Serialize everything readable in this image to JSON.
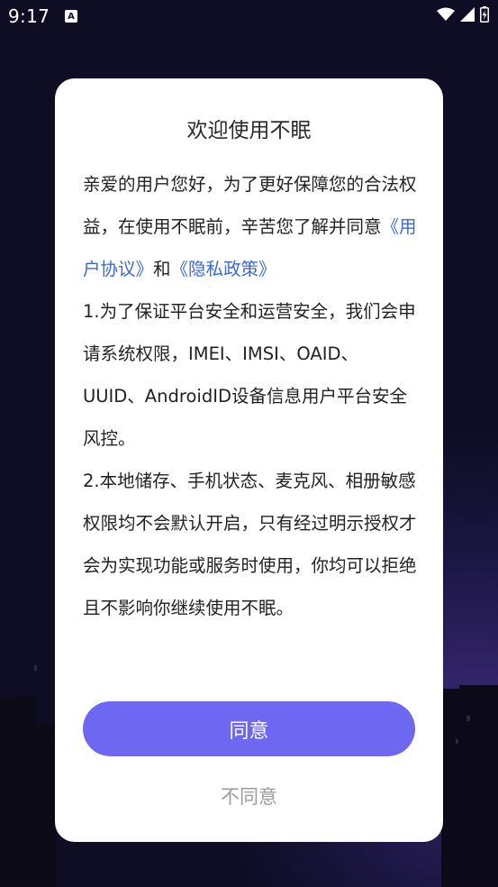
{
  "status_bar": {
    "time": "9:17",
    "notification_icon": "A",
    "icons": [
      "wifi-icon",
      "cellular-signal-icon",
      "battery-charging-icon"
    ]
  },
  "dialog": {
    "title": "欢迎使用不眠",
    "intro_text": "亲爱的用户您好，为了更好保障您的合法权益，在使用不眠前，辛苦您了解并同意",
    "user_agreement_link": "《用户协议》",
    "conjunction": "和",
    "privacy_policy_link": "《隐私政策》",
    "item_1": "1.为了保证平台安全和运营安全，我们会申请系统权限，IMEI、IMSI、OAID、UUID、AndroidID设备信息用户平台安全风控。",
    "item_2": "2.本地储存、手机状态、麦克风、相册敏感权限均不会默认开启，只有经过明示授权才会为实现功能或服务时使用，你均可以拒绝且不影响你继续使用不眠。",
    "agree_label": "同意",
    "disagree_label": "不同意"
  },
  "colors": {
    "accent_button": "#6e67f2",
    "link": "#3a68d9",
    "background": "#141030"
  }
}
